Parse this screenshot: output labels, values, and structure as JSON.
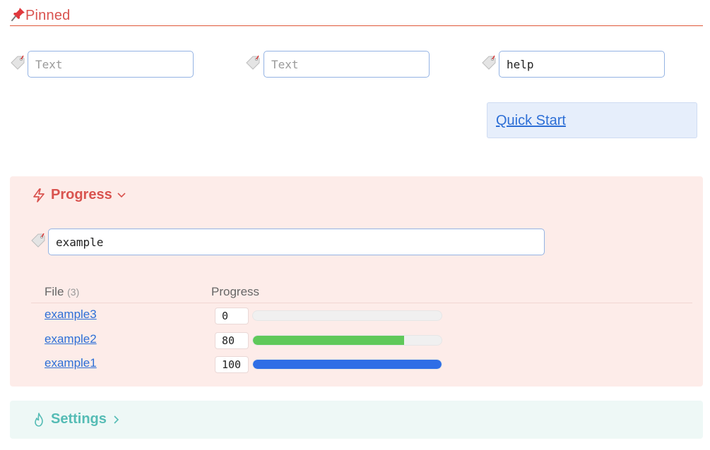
{
  "header": {
    "title": "Pinned"
  },
  "pinned_inputs": [
    {
      "placeholder": "Text",
      "value": ""
    },
    {
      "placeholder": "Text",
      "value": ""
    },
    {
      "placeholder": "Text",
      "value": "help"
    }
  ],
  "quick_start": {
    "label": "Quick Start"
  },
  "progress_section": {
    "title": "Progress",
    "search_value": "example",
    "columns": {
      "file": "File",
      "file_count": "(3)",
      "progress": "Progress"
    },
    "rows": [
      {
        "file": "example3",
        "value": "0",
        "percent": 0,
        "color": "#5fc95a"
      },
      {
        "file": "example2",
        "value": "80",
        "percent": 80,
        "color": "#5fc95a"
      },
      {
        "file": "example1",
        "value": "100",
        "percent": 100,
        "color": "#2f6ee6"
      }
    ]
  },
  "settings_section": {
    "title": "Settings"
  },
  "colors": {
    "accent_red": "#d9534f",
    "link_blue": "#2d6fd6",
    "teal": "#55bcb5"
  }
}
